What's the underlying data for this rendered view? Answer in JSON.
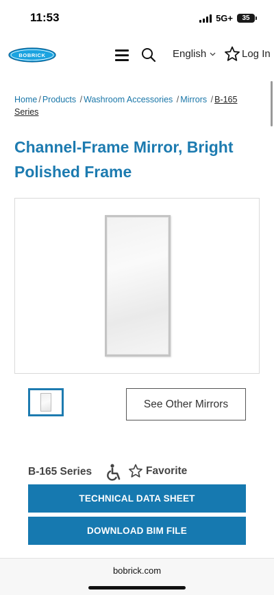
{
  "status": {
    "time": "11:53",
    "network": "5G+",
    "battery": "35"
  },
  "header": {
    "logo_text": "BOBRICK",
    "language": "English",
    "login": "Log In",
    "brand_color": "#1d7bb0"
  },
  "breadcrumb": {
    "items": [
      "Home",
      "Products",
      "Washroom Accessories",
      "Mirrors"
    ],
    "current": "B-165 Series"
  },
  "product": {
    "title": "Channel-Frame Mirror, Bright Polished Frame",
    "see_other": "See Other Mirrors",
    "series": "B-165 Series",
    "favorite": "Favorite",
    "tech_sheet": "TECHNICAL DATA SHEET",
    "bim_file": "DOWNLOAD BIM FILE"
  },
  "footer": {
    "domain": "bobrick.com"
  }
}
